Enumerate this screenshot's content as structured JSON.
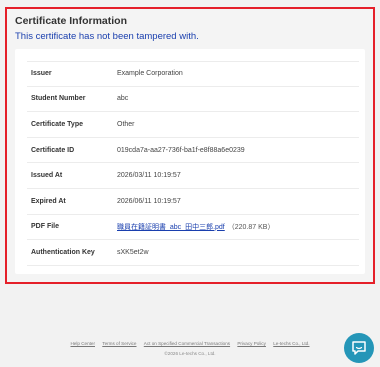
{
  "header": {
    "title": "Certificate Information",
    "status_message": "This certificate has not been tampered with."
  },
  "details": {
    "rows": [
      {
        "label": "Issuer",
        "value": "Example Corporation"
      },
      {
        "label": "Student Number",
        "value": "abc"
      },
      {
        "label": "Certificate Type",
        "value": "Other"
      },
      {
        "label": "Certificate ID",
        "value": "019cda7a-aa27-736f-ba1f-e8f88a6e0239"
      },
      {
        "label": "Issued At",
        "value": "2026/03/11 10:19:57"
      },
      {
        "label": "Expired At",
        "value": "2026/06/11 10:19:57"
      },
      {
        "label": "PDF File",
        "file_name": "職員在籍証明書_abc_田中三郎.pdf",
        "file_size": "（220.87 KB）"
      },
      {
        "label": "Authentication Key",
        "value": "sXK5et2w"
      }
    ]
  },
  "footer": {
    "links": [
      "Help Center",
      "Terms of Service",
      "Act on Specified Commercial Transactions",
      "Privacy Policy",
      "Le-techs Co., Ltd."
    ],
    "copyright": "©2026 Le-techs Co., Ltd."
  },
  "icons": {
    "chat": "chat-bubble-icon"
  },
  "colors": {
    "highlight_border": "#e5202a",
    "accent_blue": "#1a3fae",
    "chat_button": "#2596b8"
  }
}
